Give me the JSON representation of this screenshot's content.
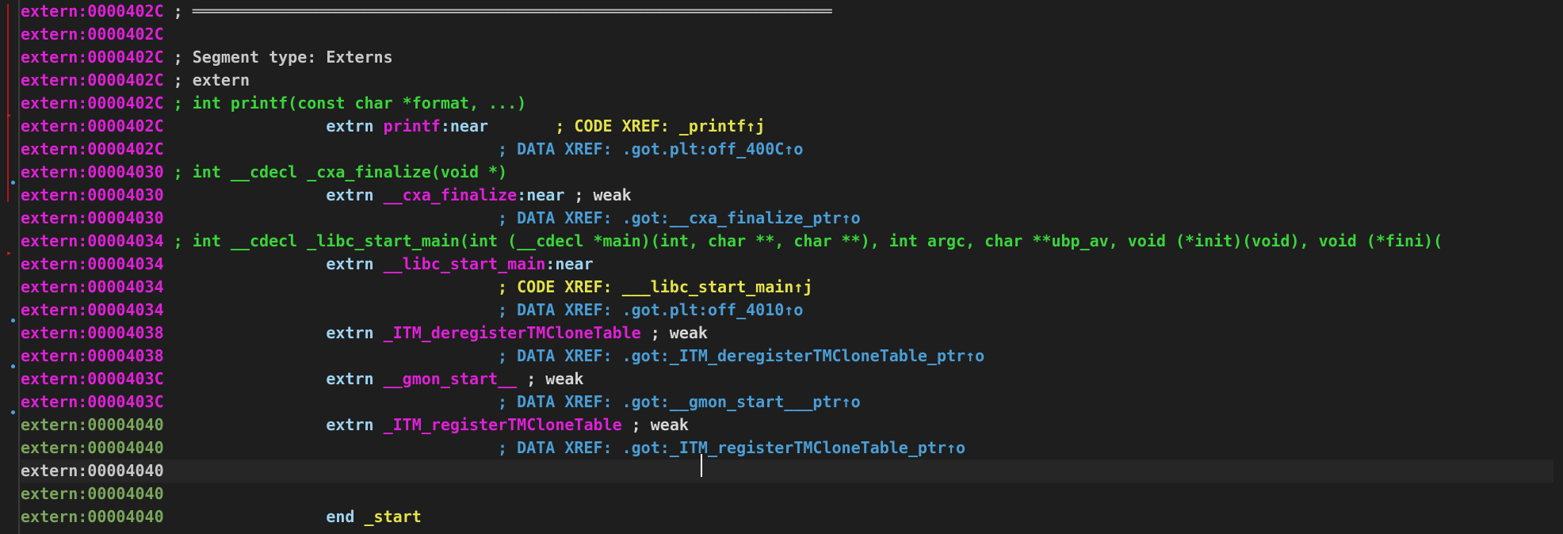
{
  "lines": [
    {
      "addr": "extern:0000402C",
      "addr_color": "m",
      "segments": [
        {
          "t": " ; ",
          "c": "tx"
        },
        {
          "t": "═══════════════════════════════════════════════════════════════════",
          "c": "tx"
        }
      ]
    },
    {
      "addr": "extern:0000402C",
      "addr_color": "m",
      "segments": []
    },
    {
      "addr": "extern:0000402C",
      "addr_color": "m",
      "segments": [
        {
          "t": " ; Segment type: Externs",
          "c": "tx"
        }
      ]
    },
    {
      "addr": "extern:0000402C",
      "addr_color": "m",
      "segments": [
        {
          "t": " ; extern",
          "c": "tx"
        }
      ]
    },
    {
      "addr": "extern:0000402C",
      "addr_color": "m",
      "segments": [
        {
          "t": " ; int printf(const char *format, ...)",
          "c": "cg"
        }
      ]
    },
    {
      "addr": "extern:0000402C",
      "addr_color": "m",
      "segments": [
        {
          "t": "                 extrn ",
          "c": "kw"
        },
        {
          "t": "printf",
          "c": "nm"
        },
        {
          "t": ":near       ",
          "c": "kw"
        },
        {
          "t": "; CODE XREF: _printf↑j",
          "c": "cy"
        }
      ]
    },
    {
      "addr": "extern:0000402C",
      "addr_color": "m",
      "segments": [
        {
          "t": "                                   ; DATA XREF: .got.plt:off_400C↑o",
          "c": "cb"
        }
      ]
    },
    {
      "addr": "extern:00004030",
      "addr_color": "m",
      "segments": [
        {
          "t": " ; int __cdecl _cxa_finalize(void *)",
          "c": "cg"
        }
      ]
    },
    {
      "addr": "extern:00004030",
      "addr_color": "m",
      "segments": [
        {
          "t": "                 extrn ",
          "c": "kw"
        },
        {
          "t": "__cxa_finalize",
          "c": "nm"
        },
        {
          "t": ":near ",
          "c": "kw"
        },
        {
          "t": "; weak",
          "c": "wk"
        }
      ]
    },
    {
      "addr": "extern:00004030",
      "addr_color": "m",
      "segments": [
        {
          "t": "                                   ; DATA XREF: .got:__cxa_finalize_ptr↑o",
          "c": "cb"
        }
      ]
    },
    {
      "addr": "extern:00004034",
      "addr_color": "m",
      "segments": [
        {
          "t": " ; int __cdecl _libc_start_main(int (__cdecl *main)(int, char **, char **), int argc, char **ubp_av, void (*init)(void), void (*fini)(",
          "c": "cg"
        }
      ]
    },
    {
      "addr": "extern:00004034",
      "addr_color": "m",
      "segments": [
        {
          "t": "                 extrn ",
          "c": "kw"
        },
        {
          "t": "__libc_start_main",
          "c": "nm"
        },
        {
          "t": ":near",
          "c": "kw"
        }
      ]
    },
    {
      "addr": "extern:00004034",
      "addr_color": "m",
      "segments": [
        {
          "t": "                                   ; CODE XREF: ___libc_start_main↑j",
          "c": "cy"
        }
      ]
    },
    {
      "addr": "extern:00004034",
      "addr_color": "m",
      "segments": [
        {
          "t": "                                   ; DATA XREF: .got.plt:off_4010↑o",
          "c": "cb"
        }
      ]
    },
    {
      "addr": "extern:00004038",
      "addr_color": "m",
      "segments": [
        {
          "t": "                 extrn ",
          "c": "kw"
        },
        {
          "t": "_ITM_deregisterTMCloneTable",
          "c": "nm"
        },
        {
          "t": " ; weak",
          "c": "wk"
        }
      ]
    },
    {
      "addr": "extern:00004038",
      "addr_color": "m",
      "segments": [
        {
          "t": "                                   ; DATA XREF: .got:_ITM_deregisterTMCloneTable_ptr↑o",
          "c": "cb"
        }
      ]
    },
    {
      "addr": "extern:0000403C",
      "addr_color": "m",
      "segments": [
        {
          "t": "                 extrn ",
          "c": "kw"
        },
        {
          "t": "__gmon_start__",
          "c": "nm"
        },
        {
          "t": " ; weak",
          "c": "wk"
        }
      ]
    },
    {
      "addr": "extern:0000403C",
      "addr_color": "m",
      "segments": [
        {
          "t": "                                   ; DATA XREF: .got:__gmon_start___ptr↑o",
          "c": "cb"
        }
      ]
    },
    {
      "addr": "extern:00004040",
      "addr_color": "g",
      "segments": [
        {
          "t": "                 extrn ",
          "c": "kw"
        },
        {
          "t": "_ITM_registerTMCloneTable",
          "c": "nm"
        },
        {
          "t": " ; weak",
          "c": "wk"
        }
      ]
    },
    {
      "addr": "extern:00004040",
      "addr_color": "g",
      "segments": [
        {
          "t": "                                   ; DATA XREF: .got:_ITM_registerTMCloneTable_ptr↑o",
          "c": "cb"
        }
      ]
    },
    {
      "addr": "extern:00004040",
      "addr_color": "w",
      "segments": [],
      "current": true
    },
    {
      "addr": "extern:00004040",
      "addr_color": "g",
      "segments": []
    },
    {
      "addr": "extern:00004040",
      "addr_color": "g",
      "segments": [
        {
          "t": "                 end ",
          "c": "kw"
        },
        {
          "t": "_start",
          "c": "cy"
        }
      ]
    }
  ],
  "markers": {
    "dot_rows": [
      8,
      14,
      16,
      18
    ],
    "arrow_rows": [
      5,
      11
    ]
  },
  "colors": {
    "background": "#1e1e1e",
    "address_magenta": "#e020d8",
    "address_green": "#7aa75c",
    "comment_green": "#3bd43b",
    "code_xref_yellow": "#e3e34a",
    "data_xref_blue": "#4a9ed6",
    "keyword": "#9fd3f0"
  }
}
